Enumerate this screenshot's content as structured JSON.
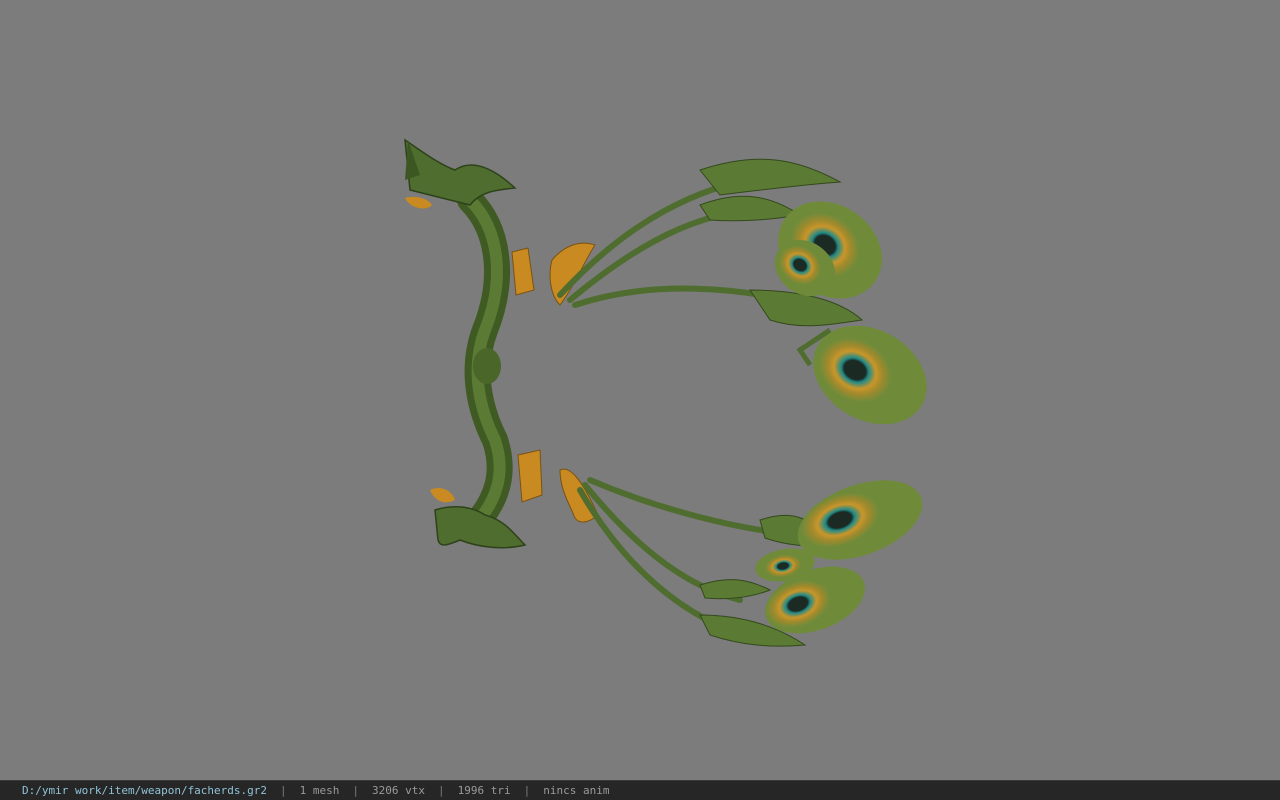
{
  "viewer": {
    "background_color": "#7c7c7c"
  },
  "model": {
    "description_icon": "peacock-feather-bow-icon",
    "colors": {
      "stem": "#4f6d2f",
      "stem_dark": "#34491d",
      "feather": "#6f8b3a",
      "eye_ring_gold": "#c9962a",
      "eye_ring_teal": "#1f8a88",
      "eye_center": "#1c2a24",
      "gold_trim": "#c98a22"
    }
  },
  "statusbar": {
    "file_path": "D:/ymir work/item/weapon/facherds.gr2",
    "mesh_count": "1 mesh",
    "vertex_count": "3206 vtx",
    "triangle_count": "1996 tri",
    "anim_info": "nincs anim",
    "separator": "|"
  }
}
